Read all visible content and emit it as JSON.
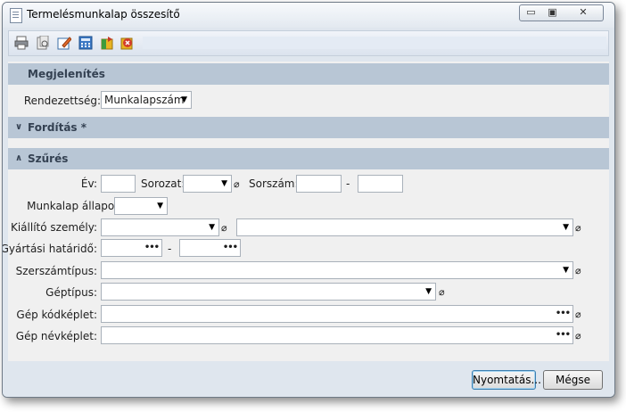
{
  "window": {
    "title": "Termelésmunkalap összesítő",
    "min_glyph": "▭",
    "max_glyph": "▣",
    "close_glyph": "✕"
  },
  "toolbar": {
    "icons": [
      "print-icon",
      "print-preview-icon",
      "edit-icon",
      "calculator-icon",
      "export-icon",
      "delete-icon"
    ]
  },
  "sections": {
    "megjelenites": {
      "title": "Megjelenítés"
    },
    "forditas": {
      "title": "Fordítás *",
      "chevron": "∨"
    },
    "szures": {
      "title": "Szűrés",
      "chevron": "∧"
    }
  },
  "display": {
    "order_label": "Rendezettség:",
    "order_value": "Munkalapszám"
  },
  "filter": {
    "year_label": "Év:",
    "series_label": "Sorozat:",
    "serial_label": "Sorszám:",
    "dash": "-",
    "state_label": "Munkalap állapot:",
    "issuer_label": "Kiállító személy:",
    "deadline_label": "Gyártási határidő:",
    "tooltype_label": "Szerszámtípus:",
    "machinetype_label": "Géptípus:",
    "codeformula_label": "Gép kódképlet:",
    "nameformula_label": "Gép névképlet:"
  },
  "glyphs": {
    "dropdown": "▼",
    "clip": "⌀",
    "dots": "•••"
  },
  "buttons": {
    "print": "Nyomtatás...",
    "cancel": "Mégse"
  },
  "colors": {
    "section_header": "#b8c6d5",
    "body": "#f0f0f0",
    "accent_border": "#3c7fb1"
  }
}
